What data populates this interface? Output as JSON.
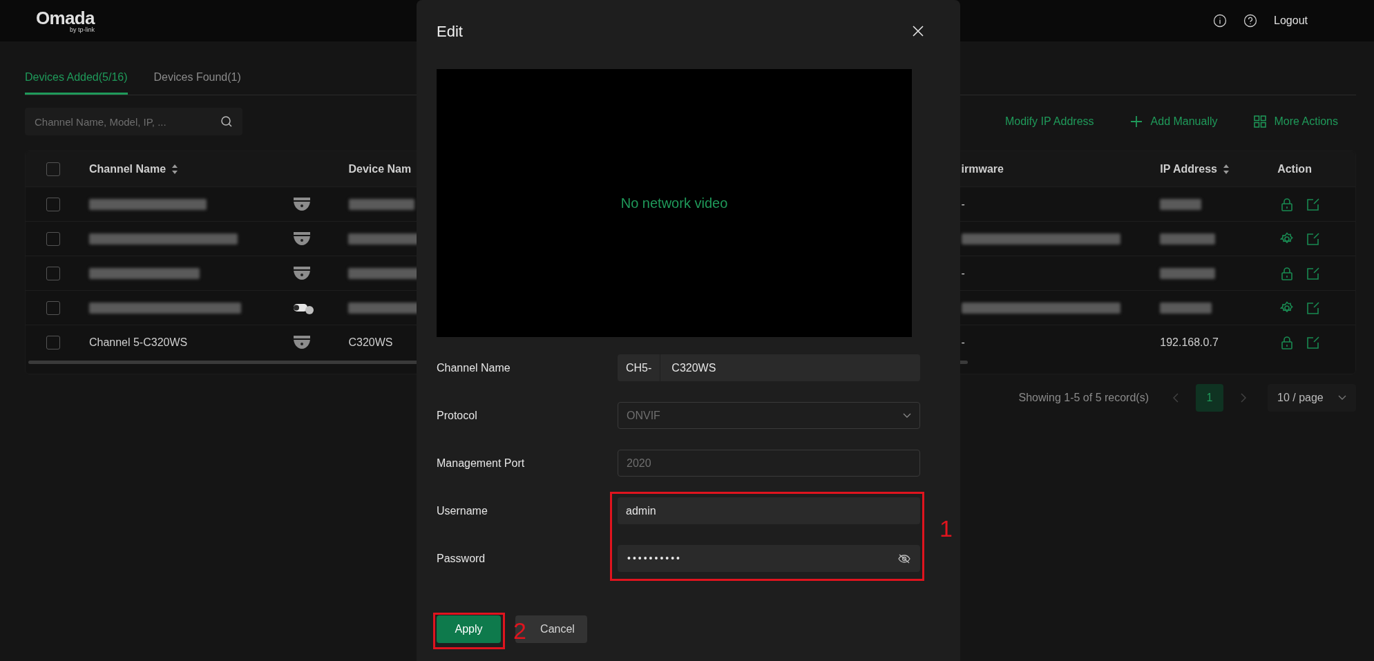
{
  "header": {
    "logo": "Omada",
    "logo_sub": "by tp-link",
    "logout": "Logout"
  },
  "tabs": [
    {
      "label": "Devices Added(5/16)",
      "selected": true
    },
    {
      "label": "Devices Found(1)",
      "selected": false
    }
  ],
  "search": {
    "placeholder": "Channel Name, Model, IP, ..."
  },
  "toolbar": [
    {
      "label": "Modify IP Address",
      "kind": "text"
    },
    {
      "label": "Add Manually",
      "kind": "plus"
    },
    {
      "label": "More Actions",
      "kind": "grid"
    }
  ],
  "table": {
    "select_all": {
      "checked": false
    },
    "columns": [
      {
        "label": "Channel Name",
        "sortable": true
      },
      {
        "label": "Device Nam",
        "sortable": false
      },
      {
        "label": "irmware",
        "sortable": false
      },
      {
        "label": "IP Address",
        "sortable": true
      },
      {
        "label": "Action",
        "sortable": false
      }
    ],
    "rows": [
      {
        "checked": false,
        "camera": {
          "kind": "dome"
        },
        "firmware": "-",
        "action": {
          "kind": "lock"
        }
      },
      {
        "checked": false,
        "camera": {
          "kind": "dome"
        },
        "action": {
          "kind": "gear"
        }
      },
      {
        "checked": false,
        "camera": {
          "kind": "dome"
        },
        "firmware": "-",
        "action": {
          "kind": "lock"
        }
      },
      {
        "checked": false,
        "camera": {
          "kind": "bullet"
        },
        "action": {
          "kind": "gear"
        }
      },
      {
        "checked": false,
        "camera": {
          "kind": "dome"
        },
        "channel_name": "Channel 5-C320WS",
        "device_name": "C320WS",
        "firmware": "-",
        "ip_address": "192.168.0.7",
        "action": {
          "kind": "lock"
        }
      }
    ]
  },
  "pagination": {
    "summary": "Showing 1-5 of 5 record(s)",
    "pages": [
      {
        "label": "1",
        "selected": true
      }
    ],
    "page_size": "10 / page"
  },
  "modal": {
    "title": "Edit",
    "video_message": "No network video",
    "fields": [
      {
        "label": "Channel Name",
        "kind": "prefixed",
        "prefix": "CH5-",
        "value": "C320WS",
        "disabled": false
      },
      {
        "label": "Protocol",
        "kind": "select",
        "value": "ONVIF",
        "disabled": true
      },
      {
        "label": "Management Port",
        "kind": "input",
        "value": "2020",
        "disabled": true
      },
      {
        "label": "Username",
        "kind": "input",
        "value": "admin",
        "disabled": false
      },
      {
        "label": "Password",
        "kind": "password",
        "value": "••••••••••",
        "disabled": false
      }
    ],
    "buttons": [
      {
        "label": "Apply",
        "kind": "primary"
      },
      {
        "label": "Cancel",
        "kind": "secondary"
      }
    ],
    "annotations": [
      {
        "label": "1"
      },
      {
        "label": "2"
      }
    ]
  }
}
